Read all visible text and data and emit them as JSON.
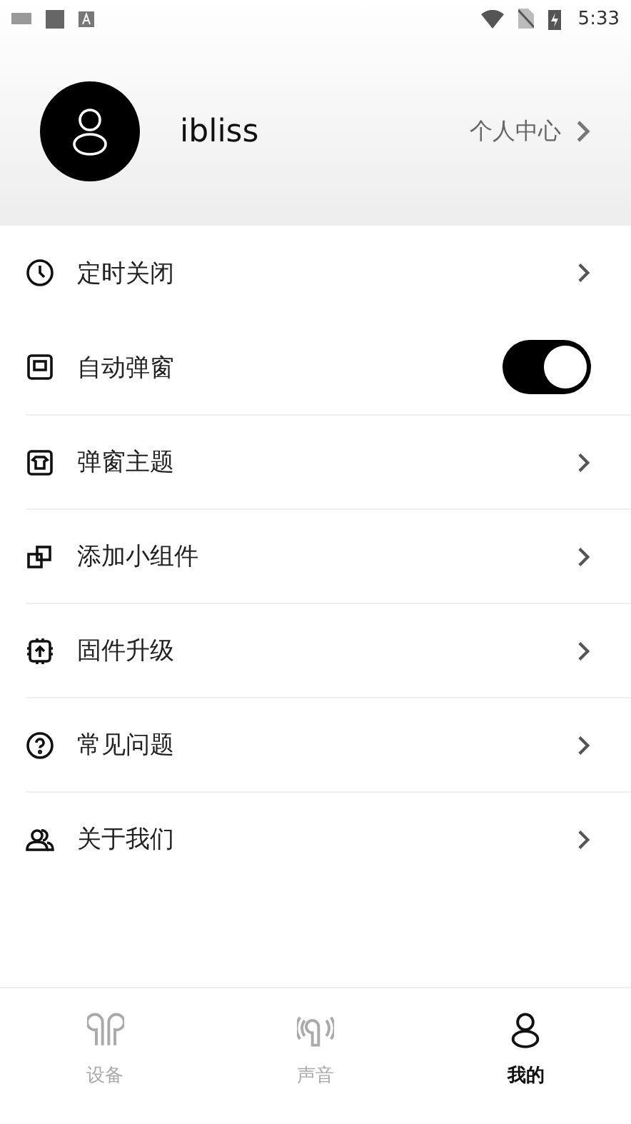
{
  "status_bar": {
    "time": "5:33"
  },
  "profile": {
    "username": "ibliss",
    "link": "个人中心"
  },
  "menu": [
    {
      "kind": "link",
      "label": "定时关闭"
    },
    {
      "kind": "toggle",
      "label": "自动弹窗",
      "on": true
    },
    {
      "kind": "link",
      "label": "弹窗主题"
    },
    {
      "kind": "link",
      "label": "添加小组件"
    },
    {
      "kind": "link",
      "label": "固件升级"
    },
    {
      "kind": "link",
      "label": "常见问题"
    },
    {
      "kind": "link",
      "label": "关于我们"
    }
  ],
  "tabs": [
    {
      "label": "设备",
      "selected": false
    },
    {
      "label": "声音",
      "selected": false
    },
    {
      "label": "我的",
      "selected": true
    }
  ]
}
